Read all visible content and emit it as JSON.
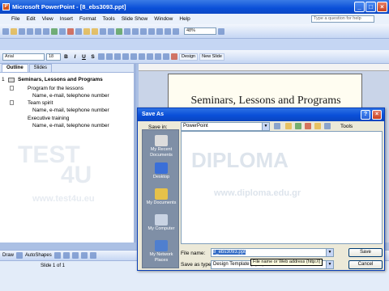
{
  "app": {
    "title": "Microsoft PowerPoint - [8_ebs3093.ppt]",
    "ask_placeholder": "Type a question for help"
  },
  "menu": [
    "File",
    "Edit",
    "View",
    "Insert",
    "Format",
    "Tools",
    "Slide Show",
    "Window",
    "Help"
  ],
  "toolbar": {
    "zoom": "48%",
    "design_label": "Design",
    "new_slide_label": "New Slide",
    "font": "Arial",
    "size": "18"
  },
  "outline": {
    "tabs": [
      "Outline",
      "Slides"
    ],
    "slide_number": "1",
    "title": "Seminars, Lessons and Programs",
    "items": [
      {
        "label": "Program for the lessons",
        "sub": "Name, e-mail, telephone number"
      },
      {
        "label": "Team spirit",
        "sub": "Name, e-mail, telephone number"
      },
      {
        "label": "Executive training",
        "sub": "Name, e-mail, telephone number"
      }
    ]
  },
  "slide": {
    "title": "Seminars, Lessons and Programs"
  },
  "watermark": {
    "brand": "4U",
    "site1": "www.test4u.eu",
    "site2": "www.diploma.edu.gr",
    "brand2": "DIPLOMA",
    "test": "TEST"
  },
  "drawbar": {
    "draw": "Draw",
    "autoshapes": "AutoShapes"
  },
  "status": {
    "slide": "Slide 1 of 1"
  },
  "dialog": {
    "title": "Save As",
    "save_in_label": "Save in:",
    "save_in_value": "PowerPoint",
    "tools_label": "Tools",
    "places": [
      "My Recent Documents",
      "Desktop",
      "My Documents",
      "My Computer",
      "My Network Places"
    ],
    "file_name_label": "File name:",
    "file_name_value": "8_ebs3093.ppt",
    "save_type_label": "Save as type:",
    "save_type_value": "Design Template (*.pot)",
    "save_button": "Save",
    "cancel_button": "Cancel",
    "tooltip": "File name or Web address (http://)"
  }
}
